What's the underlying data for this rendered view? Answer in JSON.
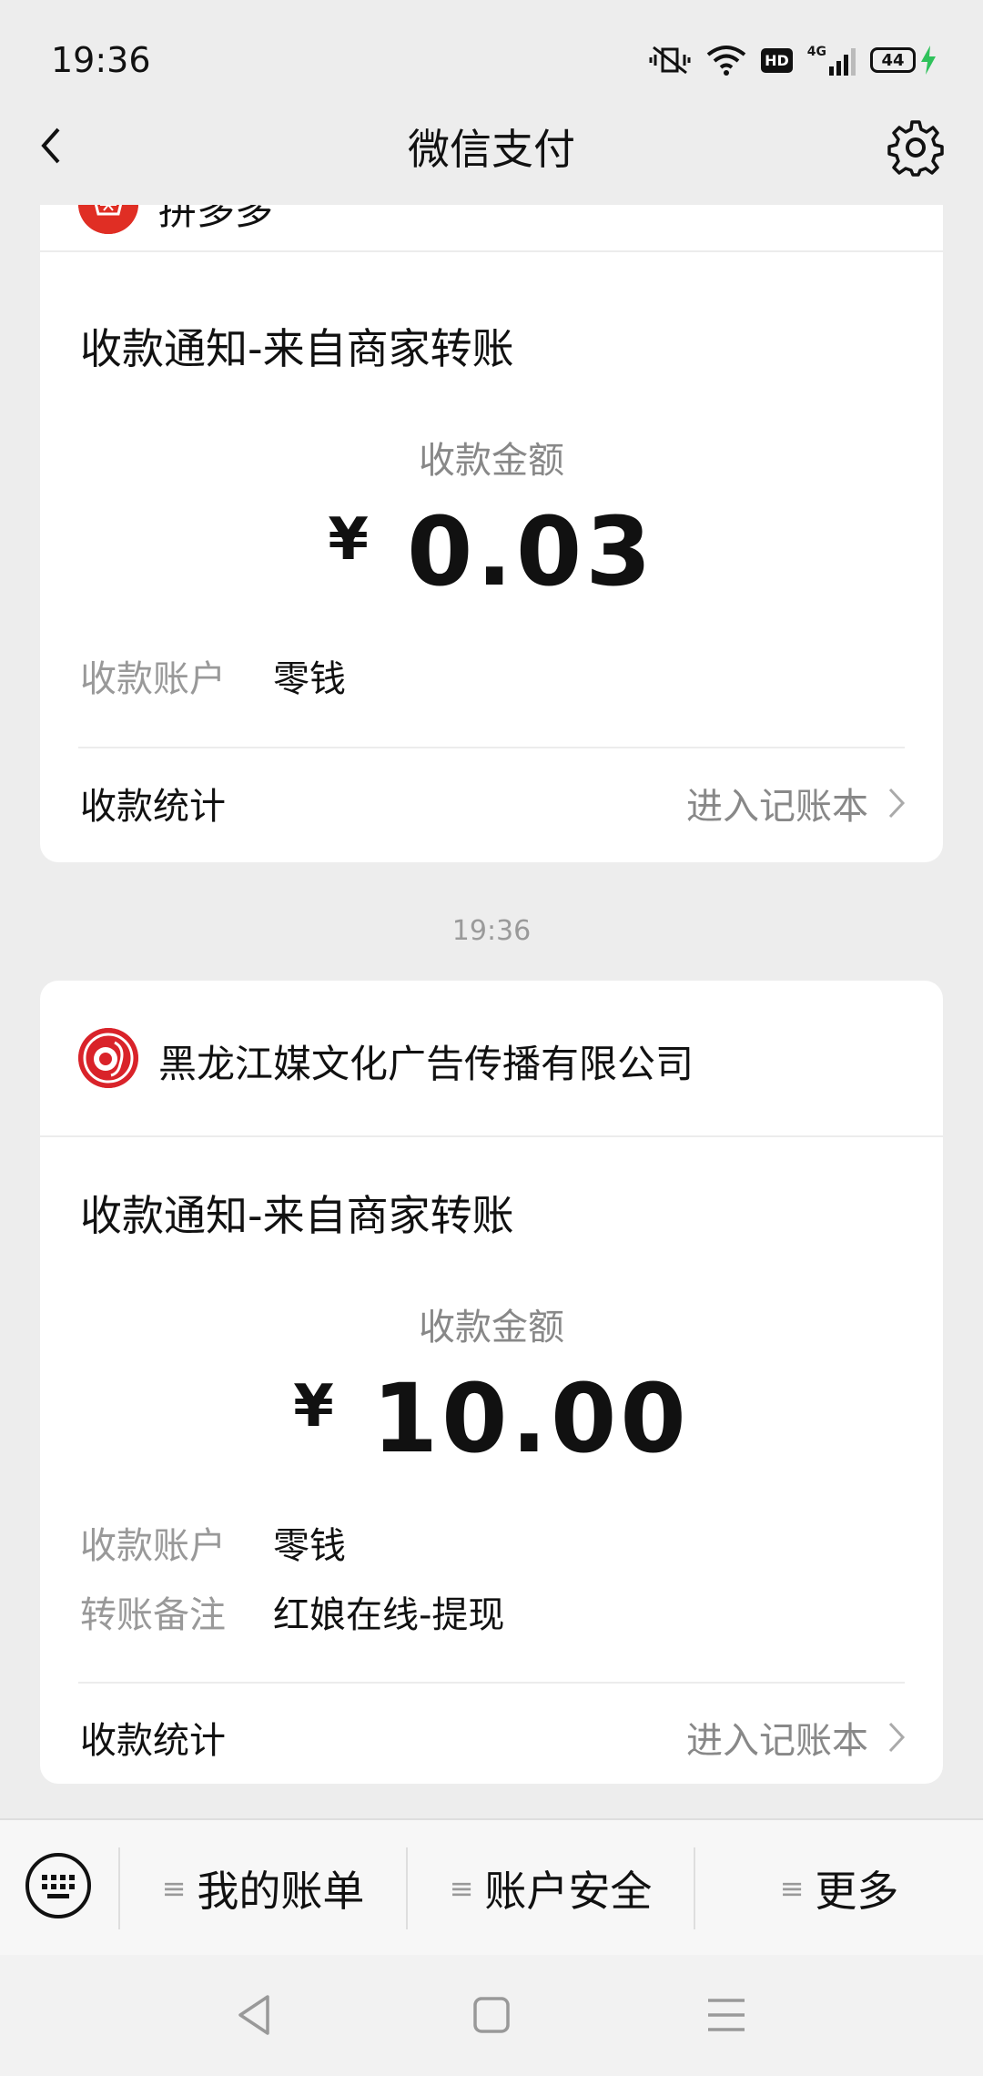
{
  "status_bar": {
    "time": "19:36",
    "network": "4G",
    "hd": "HD",
    "battery": "44"
  },
  "nav": {
    "title": "微信支付",
    "back_icon": "chevron-left-icon",
    "settings_icon": "gear-icon"
  },
  "cards": [
    {
      "merchant": "拼多多",
      "notice_title": "收款通知-来自商家转账",
      "amount_label": "收款金额",
      "currency": "¥",
      "amount": "0.03",
      "account_label": "收款账户",
      "account_value": "零钱",
      "stats_label": "收款统计",
      "stats_link": "进入记账本"
    },
    {
      "merchant": "黑龙江媒文化广告传播有限公司",
      "notice_title": "收款通知-来自商家转账",
      "amount_label": "收款金额",
      "currency": "¥",
      "amount": "10.00",
      "account_label": "收款账户",
      "account_value": "零钱",
      "remark_label": "转账备注",
      "remark_value": "红娘在线-提现",
      "stats_label": "收款统计",
      "stats_link": "进入记账本"
    }
  ],
  "timestamp": "19:36",
  "menu": {
    "items": [
      {
        "label": "我的账单"
      },
      {
        "label": "账户安全"
      },
      {
        "label": "更多"
      }
    ],
    "menu_glyph": "≡"
  },
  "colors": {
    "background": "#ededed",
    "card": "#ffffff",
    "logo_red": "#d9232a",
    "charging_green": "#2fc25b"
  }
}
